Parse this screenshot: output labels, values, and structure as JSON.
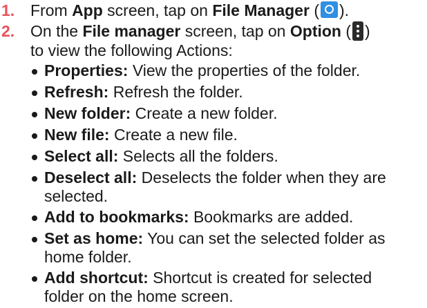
{
  "steps": [
    {
      "number": "1.",
      "lines": [
        {
          "pre": "From ",
          "b1": "App",
          "mid": " screen, tap on ",
          "b2": "File Manager",
          "post_open": " (",
          "icon": "file-manager-app-icon",
          "post_close": ")."
        }
      ]
    },
    {
      "number": "2.",
      "lines": [
        {
          "pre": "On the ",
          "b1": "File manager",
          "mid": " screen, tap on ",
          "b2": "Option",
          "post_open": " (",
          "icon": "option-menu-icon",
          "post_close": ")"
        },
        {
          "text": "to view the following Actions:"
        }
      ]
    }
  ],
  "actions": [
    {
      "term": "Properties:",
      "desc": " View the properties of the folder."
    },
    {
      "term": "Refresh:",
      "desc": " Refresh the folder."
    },
    {
      "term": "New folder:",
      "desc": " Create a new folder."
    },
    {
      "term": "New file:",
      "desc": " Create a new file."
    },
    {
      "term": "Select all:",
      "desc": " Selects all the folders."
    },
    {
      "term": "Deselect all:",
      "desc": " Deselects the folder when they are selected."
    },
    {
      "term": "Add to bookmarks:",
      "desc": " Bookmarks are added."
    },
    {
      "term": "Set as home:",
      "desc": " You can set the selected folder as home folder."
    },
    {
      "term": "Add shortcut:",
      "desc": " Shortcut is created for selected folder on the home screen."
    }
  ],
  "colors": {
    "step_number": "#e8525a",
    "text": "#1a1a1a",
    "app_icon": "#2f8fe3",
    "option_icon": "#2b2b2b"
  }
}
